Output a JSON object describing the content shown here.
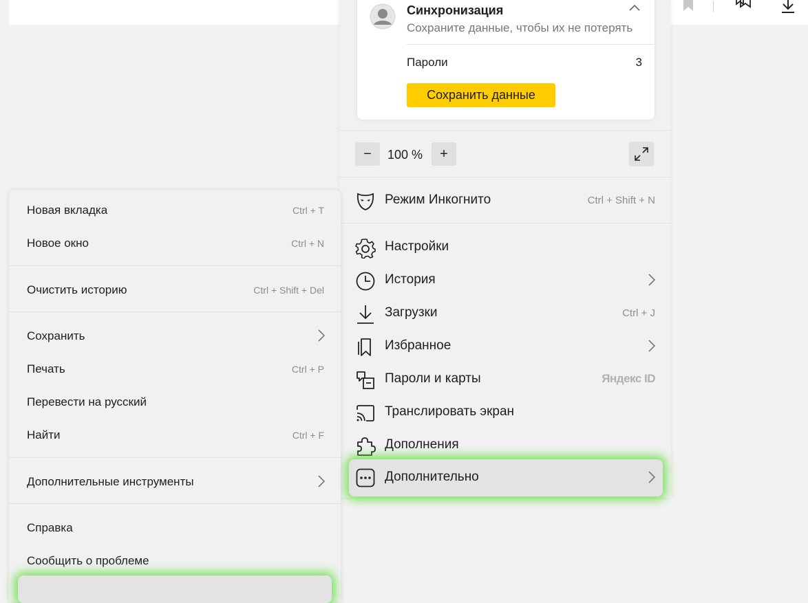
{
  "main_menu": {
    "sync": {
      "title": "Синхронизация",
      "subtitle": "Сохраните данные, чтобы их не потерять",
      "passwords_label": "Пароли",
      "passwords_count": "3",
      "save_button": "Сохранить данные"
    },
    "zoom": {
      "minus": "−",
      "value": "100 %",
      "plus": "+"
    },
    "incognito": {
      "label": "Режим Инкогнито",
      "shortcut": "Ctrl + Shift + N"
    },
    "items": [
      {
        "label": "Настройки",
        "icon": "gear-icon"
      },
      {
        "label": "История",
        "icon": "clock-icon"
      },
      {
        "label": "Загрузки",
        "shortcut": "Ctrl + J",
        "icon": "download-icon"
      },
      {
        "label": "Избранное",
        "icon": "bookmarks-icon"
      },
      {
        "label": "Пароли и карты",
        "badge": "Яндекс ID",
        "icon": "key-card-icon"
      },
      {
        "label": "Транслировать экран",
        "icon": "cast-icon"
      },
      {
        "label": "Дополнения",
        "icon": "puzzle-icon"
      },
      {
        "label": "Дополнительно",
        "icon": "more-icon"
      }
    ]
  },
  "sub_menu": {
    "items": [
      {
        "label": "Новая вкладка",
        "shortcut": "Ctrl + T"
      },
      {
        "label": "Новое окно",
        "shortcut": "Ctrl + N"
      },
      {
        "label": "Очистить историю",
        "shortcut": "Ctrl + Shift + Del"
      },
      {
        "label": "Сохранить"
      },
      {
        "label": "Печать",
        "shortcut": "Ctrl + P"
      },
      {
        "label": "Перевести на русский"
      },
      {
        "label": "Найти",
        "shortcut": "Ctrl + F"
      },
      {
        "label": "Дополнительные инструменты"
      },
      {
        "label": "Справка"
      },
      {
        "label": "Сообщить о проблеме"
      }
    ]
  },
  "colors": {
    "accent_yellow": "#ffcc00",
    "highlight_glow": "#50dc28",
    "panel_bg": "#f1f1f1"
  }
}
